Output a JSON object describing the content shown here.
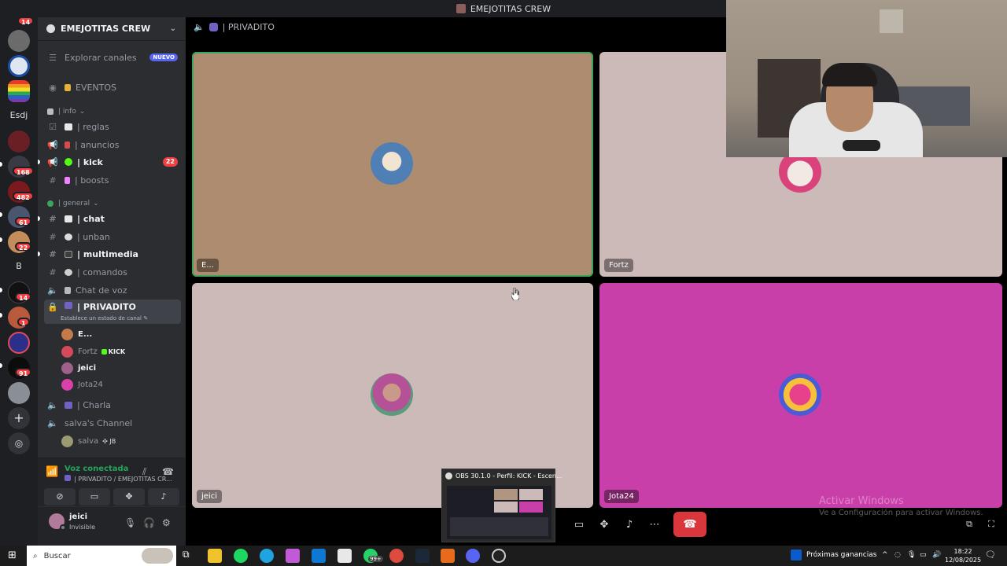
{
  "window": {
    "title": "EMEJOTITAS CREW"
  },
  "servers": {
    "top_badge": "14",
    "esdj_label": "Esdj",
    "b_label": "B",
    "badges": [
      "168",
      "482",
      "61",
      "22",
      "14",
      "1",
      "91"
    ]
  },
  "guild": {
    "name": "EMEJOTITAS CREW"
  },
  "channels": {
    "explore_label": "Explorar canales",
    "explore_badge": "NUEVO",
    "events_label": "EVENTOS",
    "cat_info": "| info",
    "reglas": "| reglas",
    "anuncios": "| anuncios",
    "kick": "| kick",
    "kick_badge": "22",
    "boosts": "| boosts",
    "cat_general": "| general",
    "chat": "| chat",
    "unban": "| unban",
    "multimedia": "| multimedia",
    "comandos": "| comandos",
    "chat_voz": "Chat de voz",
    "privadito": "| PRIVADITO",
    "privadito_status": "Establece un estado de canal",
    "charla": "| Charla",
    "salva_channel": "salva's Channel"
  },
  "voice_users": [
    {
      "name": "E...",
      "bold": true,
      "color": "#c47a4a"
    },
    {
      "name": "Fortz",
      "bold": false,
      "color": "#d44a5a",
      "tag": "KICK"
    },
    {
      "name": "jeici",
      "bold": true,
      "color": "#a0608c"
    },
    {
      "name": "Jota24",
      "bold": false,
      "color": "#d940a8"
    }
  ],
  "salva_user": {
    "name": "salva",
    "tag": "JB"
  },
  "voice_panel": {
    "title": "Voz conectada",
    "subtitle": "| PRIVADITO / EMEJOTITAS CR..."
  },
  "user_panel": {
    "name": "jeici",
    "status": "Invisible"
  },
  "call": {
    "channel_label": "| PRIVADITO",
    "tiles": [
      {
        "name": "E...",
        "bg": "#ad8c70"
      },
      {
        "name": "Fortz",
        "bg": "#cbbab8"
      },
      {
        "name": "jeici",
        "bg": "#cbbab8"
      },
      {
        "name": "Jota24",
        "bg": "#c93fa9"
      }
    ]
  },
  "obs_preview": {
    "title": "OBS 30.1.0 - Perfil: KICK - Escen..."
  },
  "windows_watermark": {
    "line1": "Activar Windows",
    "line2": "Ve a Configuración para activar Windows."
  },
  "taskbar": {
    "search_placeholder": "Buscar",
    "whatsapp_badge": "99+",
    "news_label": "Próximas ganancias",
    "time": "18:22",
    "date": "12/08/2025"
  },
  "colors": {
    "accent": "#5865f2",
    "connected": "#23a55a",
    "danger": "#da373c",
    "speaking": "#3ba55c"
  }
}
